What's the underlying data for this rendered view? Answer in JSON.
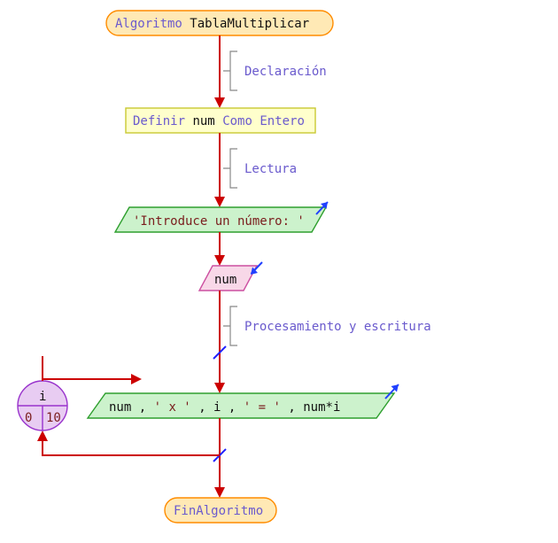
{
  "title_kw": "Algoritmo",
  "title_name": "TablaMultiplicar",
  "section1": "Declaración",
  "def_kw1": "Definir",
  "def_var": "num",
  "def_kw2": "Como Entero",
  "section2": "Lectura",
  "prompt": "'Introduce un número: '",
  "input_var": "num",
  "section3": "Procesamiento y escritura",
  "expr_parts": {
    "p1": "num",
    "p2": ", ",
    "p3": "' x '",
    "p4": ", ",
    "p5": "i",
    "p6": ", ",
    "p7": "' = '",
    "p8": ", ",
    "p9": "num*i"
  },
  "loop_var": "i",
  "loop_from": "0",
  "loop_to": "10",
  "end_kw": "FinAlgoritmo"
}
